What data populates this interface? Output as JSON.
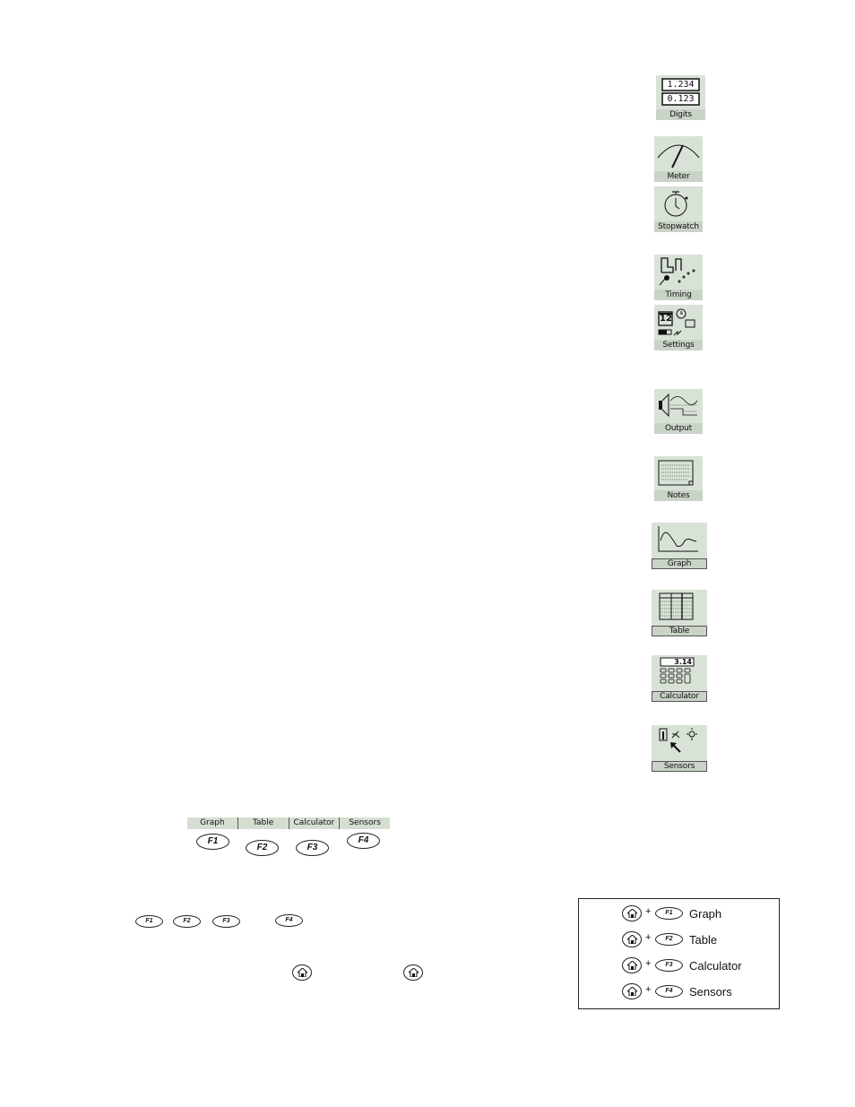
{
  "app_icons": [
    {
      "id": "digits",
      "label": "Digits",
      "icon": "digits-icon",
      "readouts": [
        "1.234",
        "0.123"
      ]
    },
    {
      "id": "meter",
      "label": "Meter",
      "icon": "meter-icon"
    },
    {
      "id": "stopwatch",
      "label": "Stopwatch",
      "icon": "stopwatch-icon"
    },
    {
      "id": "timing",
      "label": "Timing",
      "icon": "timing-icon"
    },
    {
      "id": "settings",
      "label": "Settings",
      "icon": "settings-icon",
      "date_number": "12"
    },
    {
      "id": "output",
      "label": "Output",
      "icon": "speaker-icon"
    },
    {
      "id": "notes",
      "label": "Notes",
      "icon": "notepad-icon"
    },
    {
      "id": "graph",
      "label": "Graph",
      "icon": "graph-icon"
    },
    {
      "id": "table",
      "label": "Table",
      "icon": "table-icon"
    },
    {
      "id": "calculator",
      "label": "Calculator",
      "icon": "calculator-icon",
      "display": "3.14"
    },
    {
      "id": "sensors",
      "label": "Sensors",
      "icon": "sensors-icon"
    }
  ],
  "function_bar": {
    "labels": [
      "Graph",
      "Table",
      "Calculator",
      "Sensors"
    ],
    "keys": [
      "F1",
      "F2",
      "F3",
      "F4"
    ]
  },
  "inline_keys": [
    "F1",
    "F2",
    "F3",
    "F4"
  ],
  "home_key": "home-icon",
  "shortcuts": [
    {
      "key": "F1",
      "plus": "+",
      "name": "Graph"
    },
    {
      "key": "F2",
      "plus": "+",
      "name": "Table"
    },
    {
      "key": "F3",
      "plus": "+",
      "name": "Calculator"
    },
    {
      "key": "F4",
      "plus": "+",
      "name": "Sensors"
    }
  ]
}
